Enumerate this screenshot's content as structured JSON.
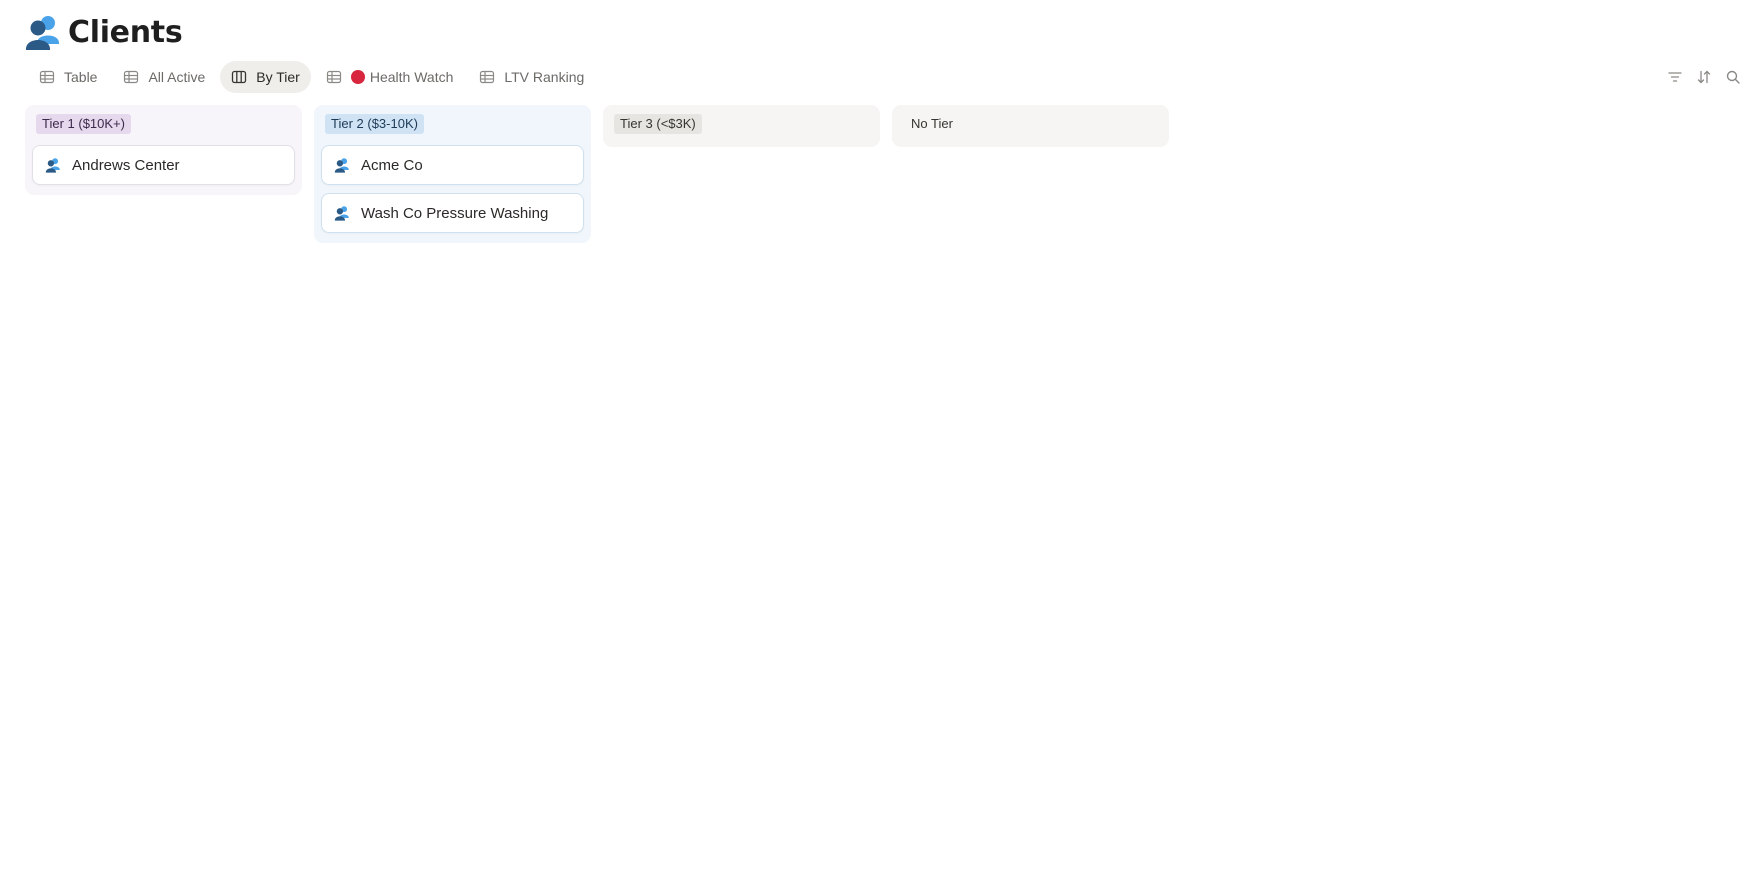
{
  "page": {
    "title": "Clients",
    "icon": "people-icon"
  },
  "tabs": [
    {
      "label": "Table",
      "icon": "table-icon",
      "active": false
    },
    {
      "label": "All Active",
      "icon": "table-icon",
      "active": false
    },
    {
      "label": "By Tier",
      "icon": "board-icon",
      "active": true
    },
    {
      "label": "Health Watch",
      "icon": "table-icon",
      "badge": "red-circle",
      "active": false
    },
    {
      "label": "LTV Ranking",
      "icon": "table-icon",
      "active": false
    }
  ],
  "toolbar": {
    "filter_icon": "filter-icon",
    "sort_icon": "sort-icon",
    "search_icon": "search-icon"
  },
  "columns": [
    {
      "label": "Tier 1 ($10K+)",
      "color": "#e6d9ee",
      "cards": [
        {
          "title": "Andrews Center",
          "icon": "people-icon"
        }
      ]
    },
    {
      "label": "Tier 2 ($3-10K)",
      "color": "#cfe3f5",
      "cards": [
        {
          "title": "Acme Co",
          "icon": "people-icon"
        },
        {
          "title": "Wash Co Pressure Washing",
          "icon": "people-icon"
        }
      ]
    },
    {
      "label": "Tier 3 (<$3K)",
      "color": "#e6e5e2",
      "cards": []
    },
    {
      "label": "No Tier",
      "cards": []
    }
  ],
  "colors": {
    "accent_red": "#d7263d",
    "people_icon_front": "#2b5a86",
    "people_icon_back": "#4aa3e8"
  }
}
